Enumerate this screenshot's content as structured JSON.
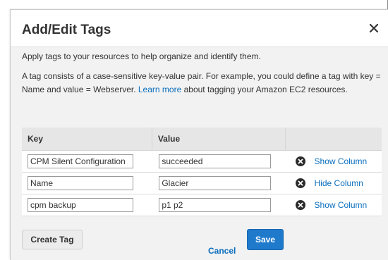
{
  "dialog": {
    "title": "Add/Edit Tags",
    "close_icon": "close-icon"
  },
  "intro_text": "Apply tags to your resources to help organize and identify them.",
  "description": {
    "before_link": "A tag consists of a case-sensitive key-value pair. For example, you could define a tag with key = Name and value = Webserver.",
    "link_text": "Learn more",
    "after_link": "about tagging your Amazon EC2 resources."
  },
  "table": {
    "headers": {
      "key": "Key",
      "value": "Value"
    },
    "rows": [
      {
        "key": "CPM Silent Configuration",
        "value": "succeeded",
        "remove_icon": "remove-circle-icon",
        "column_toggle": "Show Column"
      },
      {
        "key": "Name",
        "value": "Glacier",
        "remove_icon": "remove-circle-icon",
        "column_toggle": "Hide Column"
      },
      {
        "key": "cpm backup",
        "value": "p1 p2",
        "remove_icon": "remove-circle-icon",
        "column_toggle": "Show Column"
      }
    ]
  },
  "buttons": {
    "create_tag": "Create Tag",
    "cancel": "Cancel",
    "save": "Save"
  },
  "colors": {
    "link": "#0a6ebd",
    "primary_button": "#1f7acc",
    "body_background": "#f2f2f2",
    "header_background": "#ffffff"
  }
}
